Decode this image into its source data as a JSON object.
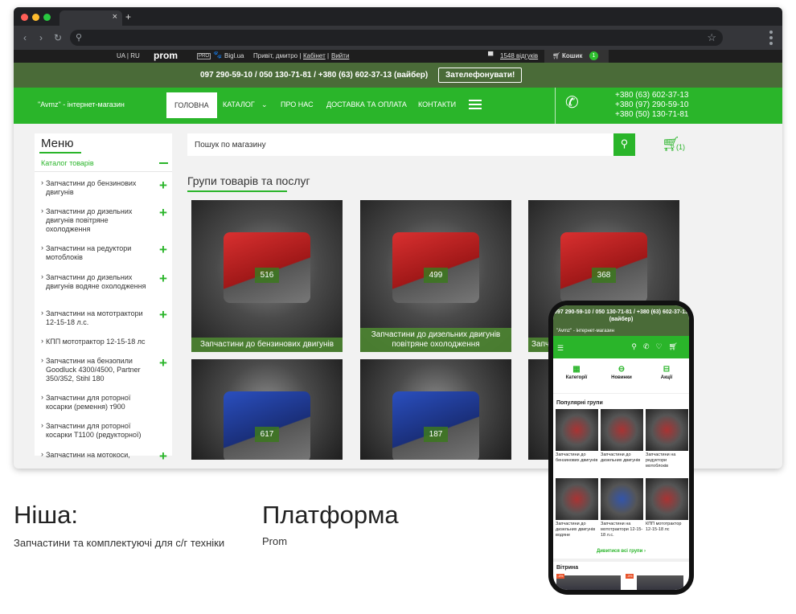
{
  "topstrip": {
    "lang": "UA | RU",
    "prom": "prom",
    "pro": "PRO",
    "bigl": "Bigl.ua",
    "greeting": "Привіт, дмитро |",
    "cabinet": "Кабінет",
    "sep": "|",
    "logout": "Вийти",
    "reviews": "1548 відгуків",
    "cart": "Кошик",
    "cart_count": "1"
  },
  "phonebar": {
    "phones": "097 290-59-10 / 050 130-71-81 / +380 (63) 602-37-13 (вайбер)",
    "call_button": "Зателефонувати!"
  },
  "nav": {
    "store": "\"Avmz\" - інтернет-магазин",
    "items": [
      "ГОЛОВНА",
      "КАТАЛОГ",
      "ПРО НАС",
      "ДОСТАВКА ТА ОПЛАТА",
      "КОНТАКТИ"
    ],
    "phones": [
      "+380 (63) 602-37-13",
      "+380 (97) 290-59-10",
      "+380 (50) 130-71-81"
    ]
  },
  "sidebar": {
    "title": "Меню",
    "catalog": "Каталог товарів",
    "items": [
      "Запчастини до бензинових двигунів",
      "Запчастини до дизельних двигунів повітряне охолодження",
      "Запчастини на редуктори мотоблоків",
      "Запчастини до дизельних двигунів водяне охолодження",
      "Запчастини на мототрактори 12-15-18 л.с.",
      "КПП мототрактор 12-15-18 лс",
      "Запчастини на бензопили Goodluck 4300/4500, Partner 350/352, Stihl 180",
      "Запчастини для роторної косарки (ремення) т900",
      "Запчастини для роторної косарки Т1100 (редукторної)",
      "Запчастини на мотокоси,"
    ]
  },
  "search": {
    "placeholder": "Пошук по магазину",
    "cart_count": "(1)"
  },
  "groups": {
    "title": "Групи товарів та послуг",
    "cards": [
      {
        "count": "516",
        "label": "Запчастини до бензинових двигунів"
      },
      {
        "count": "499",
        "label": "Запчастини до дизельних двигунів повітряне охолодження"
      },
      {
        "count": "368",
        "label": "Запч"
      },
      {
        "count": "617",
        "label": ""
      },
      {
        "count": "187",
        "label": ""
      }
    ]
  },
  "info": {
    "niche_title": "Ніша:",
    "niche_text": "Запчастини та комплектуючі для с/г техніки",
    "platform_title": "Платформа",
    "platform_text": "Prom"
  },
  "mobile": {
    "top": "097 290-59-10 / 050 130-71-81 / +380 (63) 602-37-13 (вайбер)",
    "store": "\"Avmz\" - інтернет-магазин",
    "quick": [
      "Категорії",
      "Новинки",
      "Акції"
    ],
    "popular": "Популярні групи",
    "cards": [
      "Запчастини до бензинових двигунів",
      "Запчастини до дизельних двигунів",
      "Запчастини на редуктори мотоблоків",
      "Запчастини до дизельних двигунів водяне",
      "Запчастини на мототрактори 12-15-18 л.с.",
      "КПП мототрактор 12-15-18 лс"
    ],
    "see_all": "Дивитися всі групи ›",
    "showcase": "Вітрина",
    "sale": "-3%"
  }
}
